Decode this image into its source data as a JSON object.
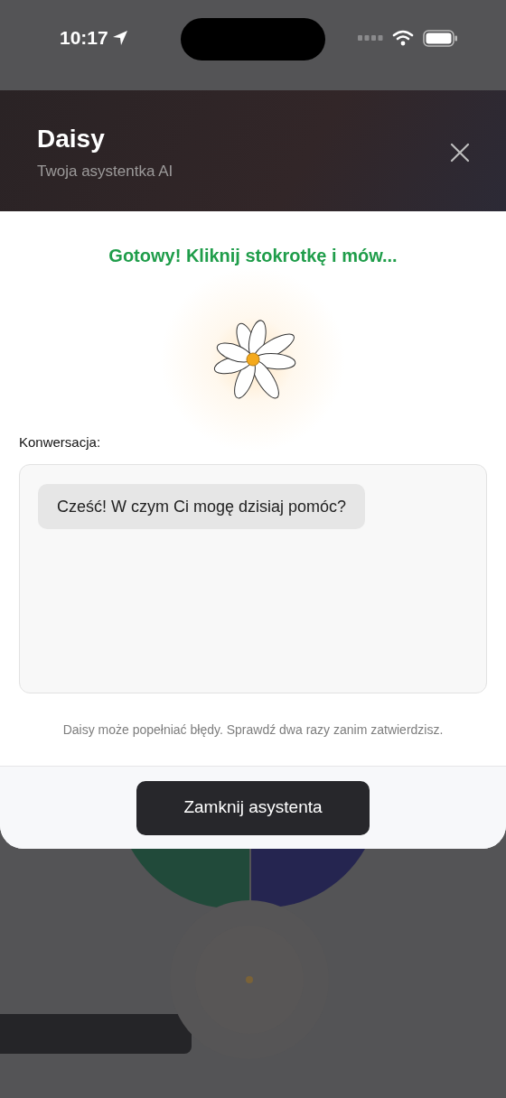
{
  "status_bar": {
    "time": "10:17"
  },
  "header": {
    "title": "Daisy",
    "subtitle": "Twoja asystentka AI"
  },
  "assistant": {
    "status": "Gotowy! Kliknij stokrotkę i mów...",
    "conversation_label": "Konwersacja:",
    "messages": [
      {
        "kind": "assistant",
        "text": "Cześć! W czym Ci mogę dzisiaj pomóc?"
      }
    ],
    "disclaimer": "Daisy może popełniać błędy. Sprawdź dwa razy zanim zatwierdzisz.",
    "close_button": "Zamknij asystenta"
  }
}
